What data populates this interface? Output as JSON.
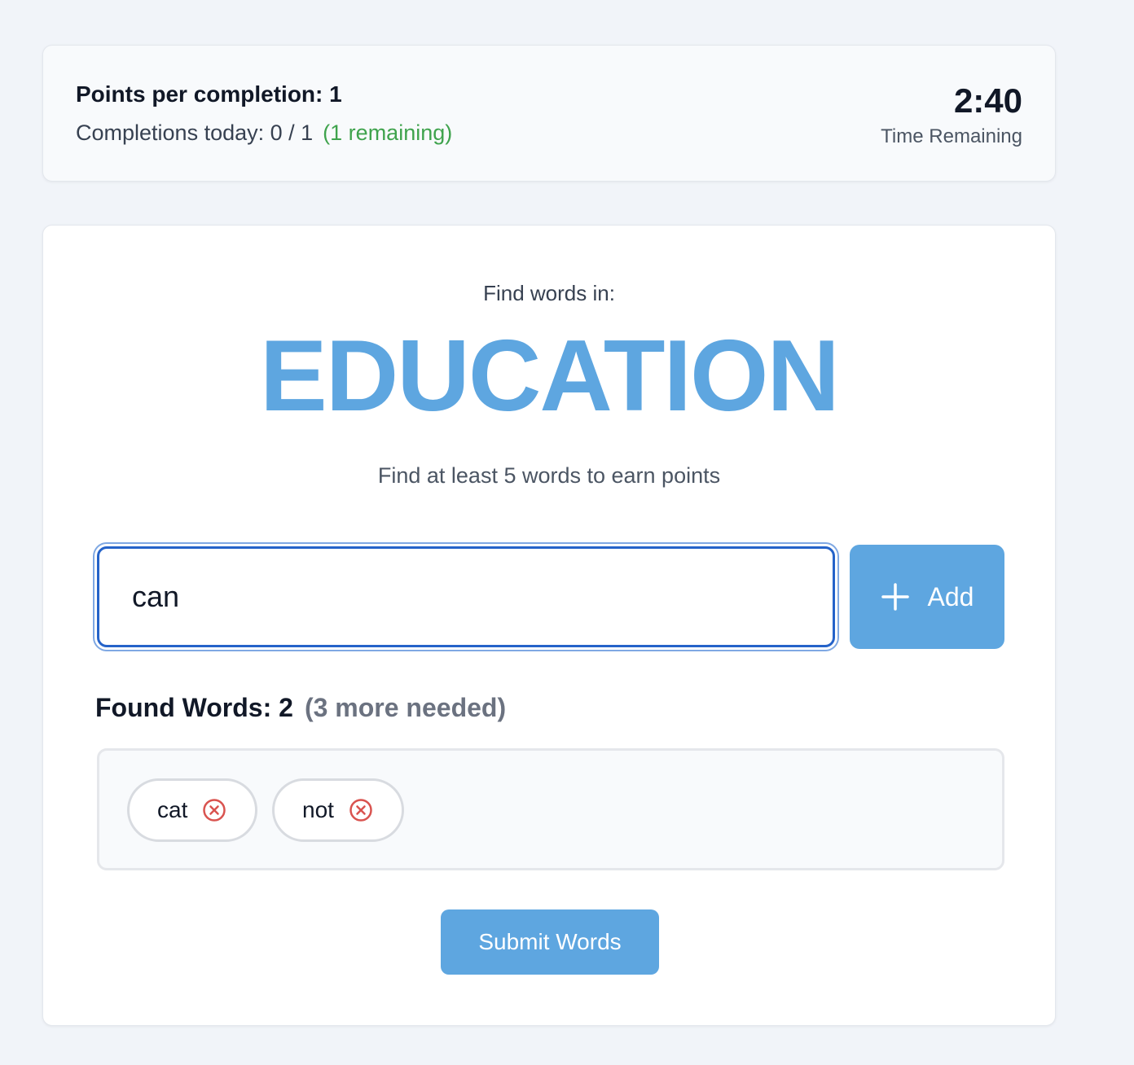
{
  "stats": {
    "points_label": "Points per completion: 1",
    "completions_label": "Completions today: 0 / 1",
    "remaining_label": "(1 remaining)",
    "timer_value": "2:40",
    "timer_label": "Time Remaining"
  },
  "game": {
    "prompt_label": "Find words in:",
    "target_word": "EDUCATION",
    "instruction": "Find at least 5 words to earn points",
    "input_value": "can",
    "add_label": "Add",
    "found_label": "Found Words: 2",
    "needed_label": "(3 more needed)",
    "found_words": [
      "cat",
      "not"
    ],
    "submit_label": "Submit Words"
  },
  "icons": {
    "add": "plus-icon",
    "remove": "close-circle-icon"
  },
  "colors": {
    "accent": "#5ea6e0",
    "remaining": "#3fa34d",
    "remove_icon": "#d9534f",
    "input_border": "#2563c9"
  }
}
